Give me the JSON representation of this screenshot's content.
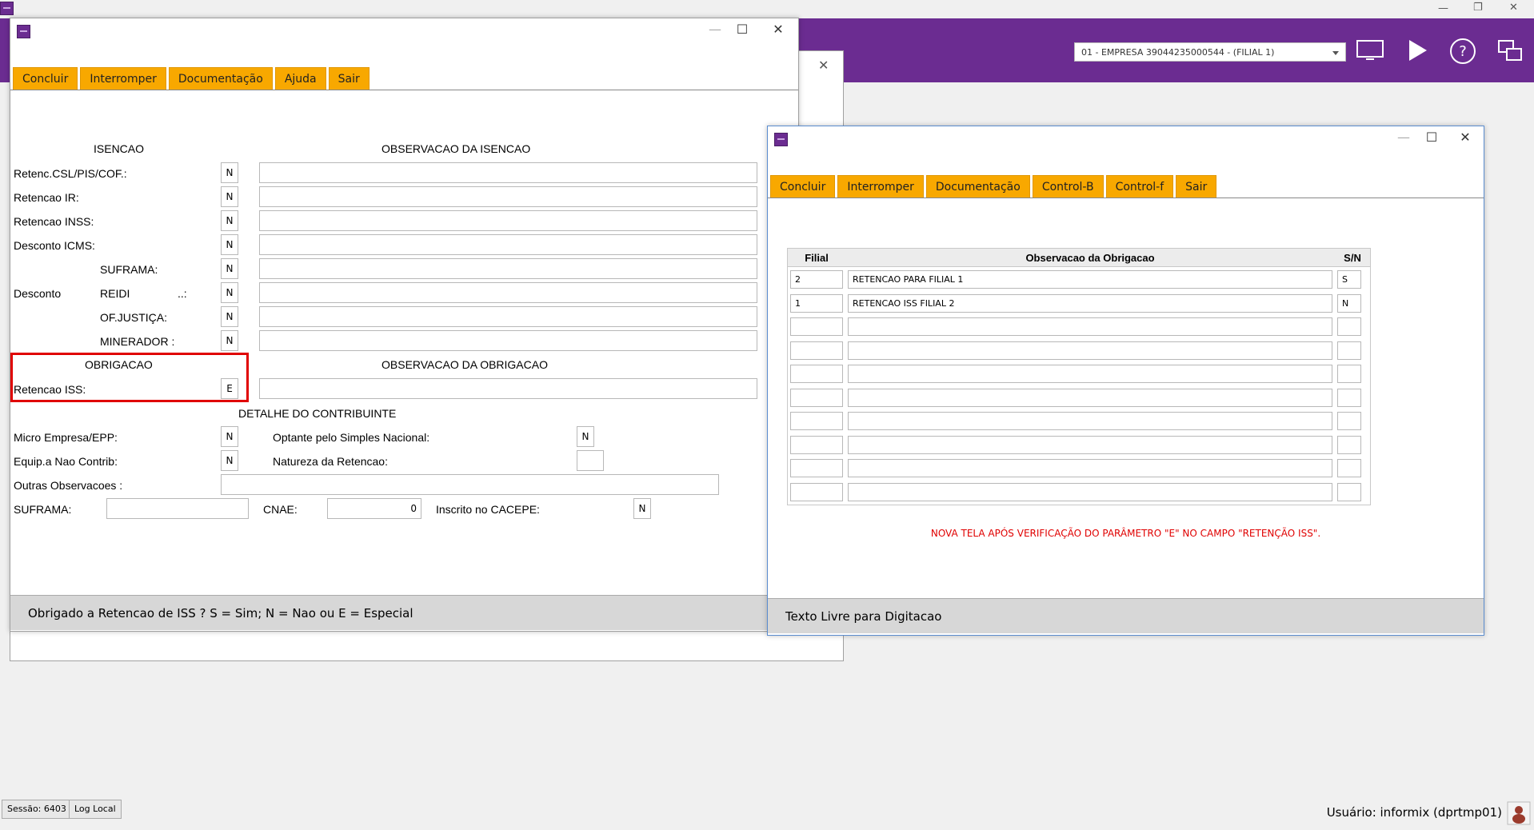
{
  "os": {
    "window_controls": {
      "minimize": "—",
      "restore": "❐",
      "close": "✕"
    }
  },
  "app": {
    "empresa_select": "01 - EMPRESA 39044235000544 - (FILIAL 1)",
    "toolbar_icons": [
      "monitor-icon",
      "play-icon",
      "help-icon",
      "windows-icon"
    ],
    "brand_color": "#6b2c91"
  },
  "left_window": {
    "menu": [
      "Concluir",
      "Interromper",
      "Documentação",
      "Ajuda",
      "Sair"
    ],
    "isencao_header": "ISENCAO",
    "obs_isencao_header": "OBSERVACAO DA ISENCAO",
    "rows": [
      {
        "label": "Retenc.CSL/PIS/COF.:",
        "value": "N"
      },
      {
        "label": "Retencao IR:",
        "value": "N"
      },
      {
        "label": "Retencao INSS:",
        "value": "N"
      },
      {
        "label": "Desconto ICMS:",
        "value": "N"
      },
      {
        "label": "SUFRAMA:",
        "value": "N"
      },
      {
        "label": "REIDI",
        "suffix": "..:",
        "value": "N"
      },
      {
        "label": "OF.JUSTIÇA:",
        "value": "N"
      },
      {
        "label": "MINERADOR :",
        "value": "N"
      }
    ],
    "desconto_label": "Desconto",
    "obrigacao_header": "OBRIGACAO",
    "obs_obrigacao_header": "OBSERVACAO DA OBRIGACAO",
    "retencao_iss_label": "Retencao ISS:",
    "retencao_iss_value": "E",
    "detalhe_header": "DETALHE DO CONTRIBUINTE",
    "micro_empresa_label": "Micro Empresa/EPP:",
    "micro_empresa_value": "N",
    "optante_label": "Optante pelo Simples Nacional:",
    "optante_value": "N",
    "equip_label": "Equip.a Nao Contrib:",
    "equip_value": "N",
    "natureza_label": "Natureza da Retencao:",
    "natureza_value": "",
    "outras_label": "Outras Observacoes :",
    "suframa_label": "SUFRAMA:",
    "cnae_label": "CNAE:",
    "cnae_value": "0",
    "cacepe_label": "Inscrito no CACEPE:",
    "cacepe_value": "N",
    "status": "Obrigado a Retencao de ISS ?  S = Sim; N = Nao ou E = Especial",
    "highlight_color": "#e00000"
  },
  "right_window": {
    "menu": [
      "Concluir",
      "Interromper",
      "Documentação",
      "Control-B",
      "Control-f",
      "Sair"
    ],
    "grid_headers": {
      "filial": "Filial",
      "obs": "Observacao da Obrigacao",
      "sn": "S/N"
    },
    "grid_rows": [
      {
        "filial": "2",
        "obs": "RETENCAO PARA FILIAL 1",
        "sn": "S"
      },
      {
        "filial": "1",
        "obs": "RETENCAO ISS FILIAL 2",
        "sn": "N"
      },
      {
        "filial": "",
        "obs": "",
        "sn": ""
      },
      {
        "filial": "",
        "obs": "",
        "sn": ""
      },
      {
        "filial": "",
        "obs": "",
        "sn": ""
      },
      {
        "filial": "",
        "obs": "",
        "sn": ""
      },
      {
        "filial": "",
        "obs": "",
        "sn": ""
      },
      {
        "filial": "",
        "obs": "",
        "sn": ""
      },
      {
        "filial": "",
        "obs": "",
        "sn": ""
      },
      {
        "filial": "",
        "obs": "",
        "sn": ""
      }
    ],
    "note": "NOVA TELA APÓS VERIFICAÇÃO DO PARÂMETRO \"E\" NO CAMPO \"RETENÇÃO ISS\".",
    "note_color": "#e00000",
    "status": "Texto Livre para Digitacao"
  },
  "footer": {
    "sessao": "Sessão: 6403",
    "log_local": "Log Local",
    "usuario": "Usuário: informix (dprtmp01)"
  }
}
